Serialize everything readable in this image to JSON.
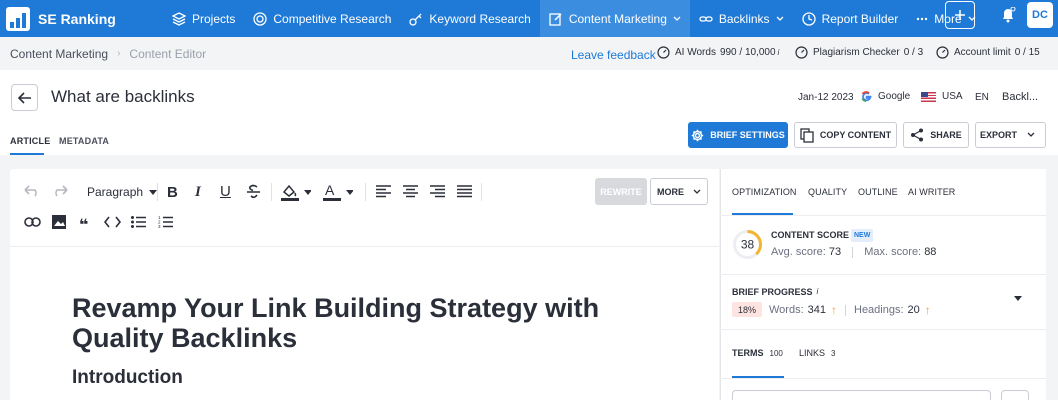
{
  "app": {
    "brand": "SE Ranking"
  },
  "nav": {
    "projects": "Projects",
    "competitive": "Competitive Research",
    "keyword": "Keyword Research",
    "content_marketing": "Content Marketing",
    "backlinks": "Backlinks",
    "report_builder": "Report Builder",
    "more": "More",
    "avatar_initials": "DC"
  },
  "breadcrumb": {
    "parent": "Content Marketing",
    "current": "Content Editor"
  },
  "header": {
    "feedback": "Leave feedback",
    "ai_words_label": "AI Words",
    "ai_words_value": "990 / 10,000",
    "plagiarism_label": "Plagiarism Checker",
    "plagiarism_value": "0 / 3",
    "account_label": "Account limit",
    "account_value": "0 / 15",
    "info": "i"
  },
  "document": {
    "title": "What are backlinks",
    "date": "Jan-12 2023",
    "engine": "Google",
    "country": "USA",
    "language": "EN",
    "keyword": "Backl..."
  },
  "tabs": {
    "article": "ARTICLE",
    "metadata": "METADATA"
  },
  "actions": {
    "brief_settings": "BRIEF SETTINGS",
    "copy_content": "COPY CONTENT",
    "share": "SHARE",
    "export": "EXPORT"
  },
  "editor": {
    "paragraph_select": "Paragraph",
    "rewrite": "REWRITE",
    "more": "MORE",
    "heading1": "Revamp Your Link Building Strategy with Quality Backlinks",
    "heading2": "Introduction"
  },
  "panel": {
    "tabs": {
      "optimization": "OPTIMIZATION",
      "quality": "QUALITY",
      "outline": "OUTLINE",
      "ai_writer": "AI WRITER"
    },
    "content_score_label": "CONTENT SCORE",
    "new_badge": "NEW",
    "score": "38",
    "score_fraction": 0.38,
    "avg_label": "Avg. score:",
    "avg_value": "73",
    "max_label": "Max. score:",
    "max_value": "88",
    "brief_label": "BRIEF PROGRESS",
    "brief_pct": "18%",
    "words_label": "Words:",
    "words_value": "341",
    "headings_label": "Headings:",
    "headings_value": "20",
    "terms_label": "TERMS",
    "terms_count": "100",
    "links_label": "LINKS",
    "links_count": "3"
  },
  "colors": {
    "brand": "#1e7ad6",
    "score_ring": "#f2b531",
    "warning": "#f0a41c",
    "badge_bg": "#fde4e1"
  }
}
